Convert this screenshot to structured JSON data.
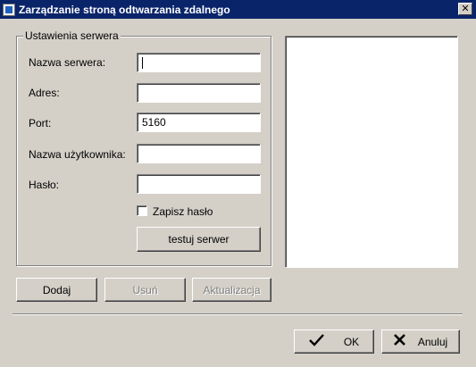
{
  "window": {
    "title": "Zarządzanie stroną odtwarzania zdalnego",
    "close_glyph": "✕"
  },
  "server_settings": {
    "legend": "Ustawienia serwera",
    "server_name_label": "Nazwa serwera:",
    "server_name_value": "",
    "address_label": "Adres:",
    "address_value": "",
    "port_label": "Port:",
    "port_value": "5160",
    "username_label": "Nazwa użytkownika:",
    "username_value": "",
    "password_label": "Hasło:",
    "password_value": "",
    "save_password_label": "Zapisz hasło",
    "save_password_checked": false,
    "test_server_label": "testuj serwer"
  },
  "actions": {
    "add_label": "Dodaj",
    "remove_label": "Usuń",
    "update_label": "Aktualizacja"
  },
  "footer": {
    "ok_label": "OK",
    "ok_icon": "check-icon",
    "cancel_label": "Anuluj",
    "cancel_icon": "x-icon"
  },
  "colors": {
    "titlebar": "#0a246a",
    "face": "#d4d0c8"
  }
}
